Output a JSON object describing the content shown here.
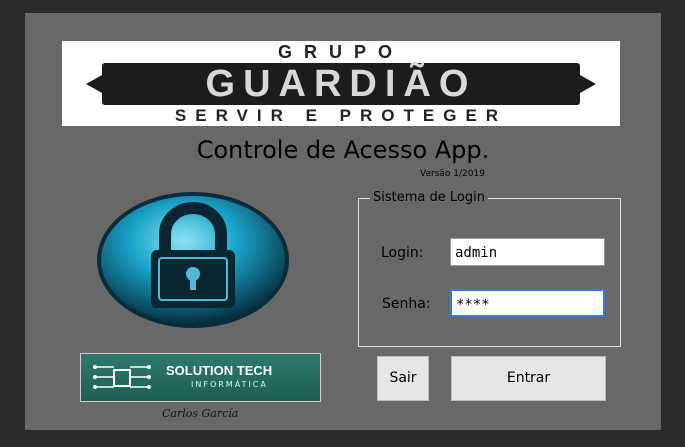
{
  "header": {
    "logo_top": "GRUPO",
    "logo_main": "GUARDIÃO",
    "logo_bottom": "SERVIR E PROTEGER",
    "title": "Controle de Acesso App.",
    "version": "Versão 1/2019"
  },
  "login_group": {
    "legend": "Sistema de Login",
    "login_label": "Login:",
    "login_value": "admin",
    "password_label": "Senha:",
    "password_value": "****"
  },
  "buttons": {
    "exit_label": "Sair",
    "enter_label": "Entrar"
  },
  "branding": {
    "company_name": "SOLUTION TECH",
    "company_sub": "INFORMÁTICA",
    "signature": "Carlos García"
  },
  "colors": {
    "window_bg": "#686868",
    "outer_bg": "#2b2b2b",
    "accent_blue": "#3a7bd5",
    "lock_cyan": "#1aa3c9",
    "brand_green": "#2f7a6d"
  },
  "icons": {
    "lock": "padlock-icon",
    "circuit": "circuit-chip-icon"
  }
}
